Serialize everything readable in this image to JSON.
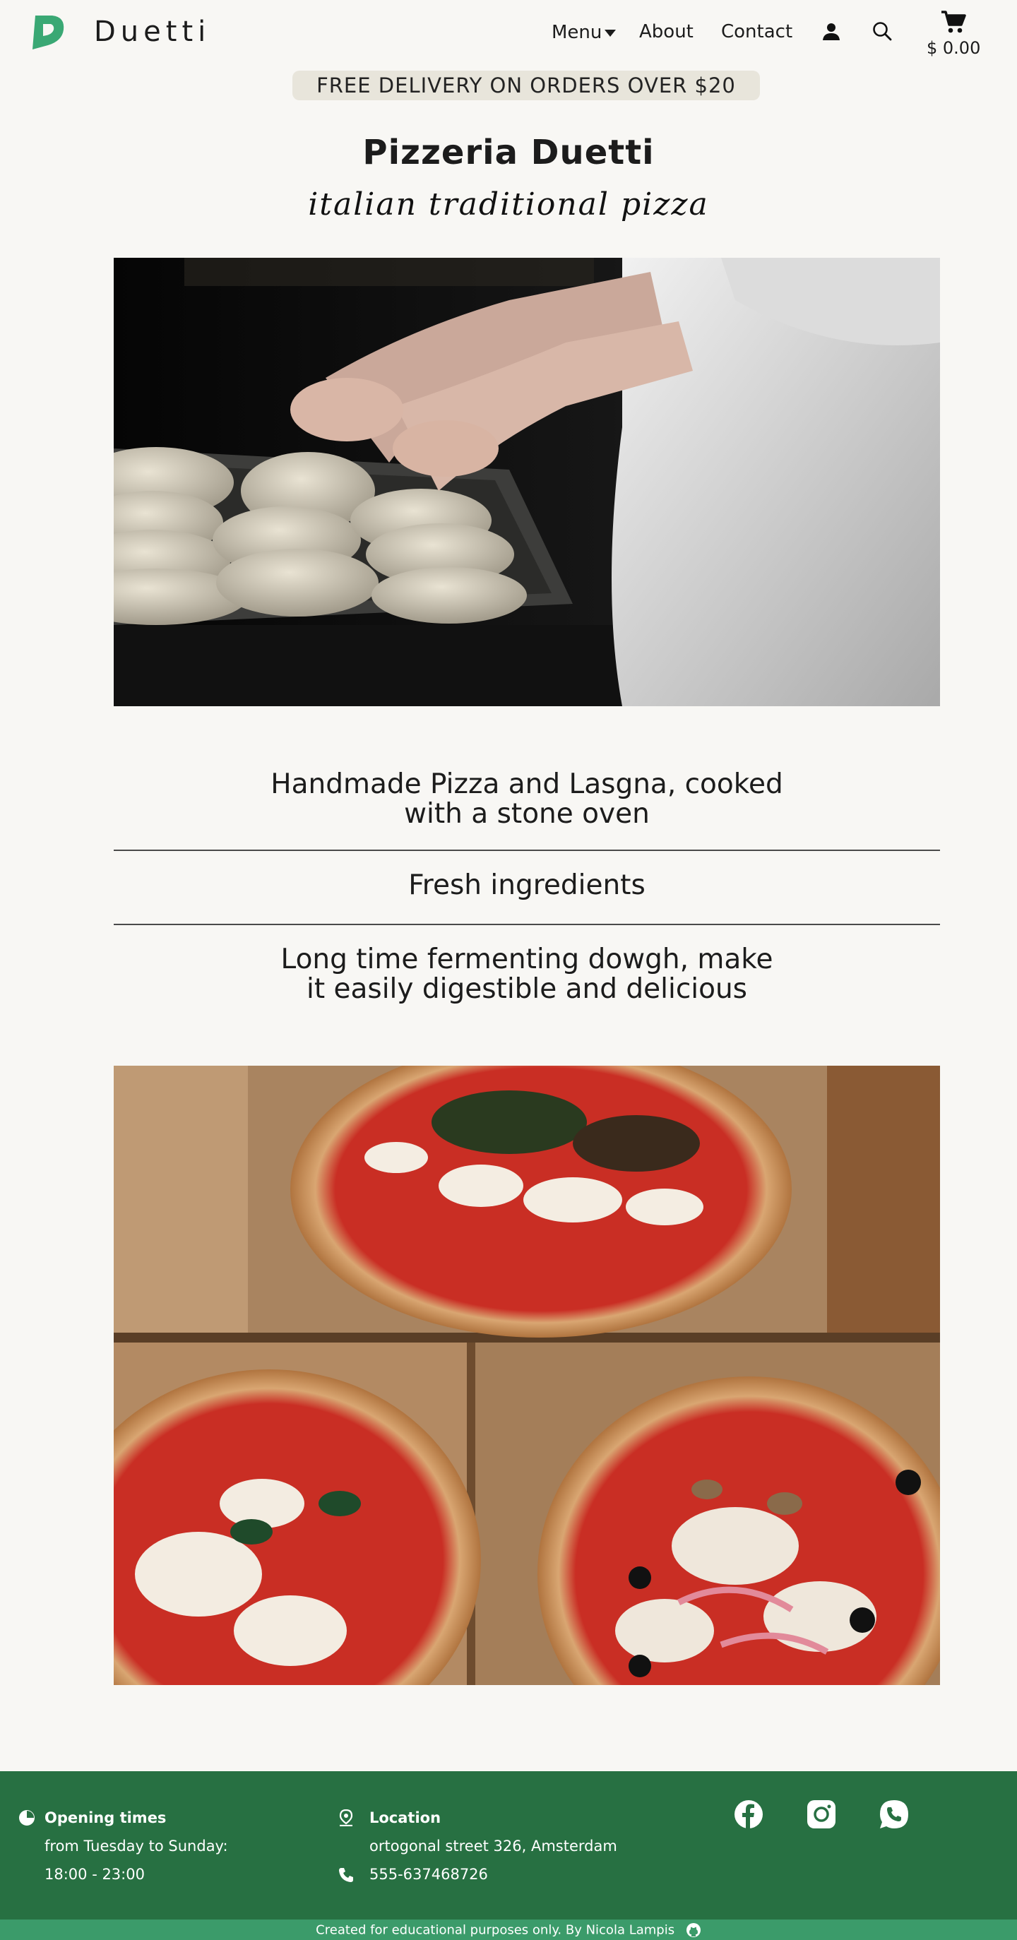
{
  "header": {
    "brand": "Duetti",
    "nav": {
      "menu": "Menu",
      "about": "About",
      "contact": "Contact"
    },
    "cart_total": "$ 0.00",
    "icons": [
      "logo-icon",
      "user-icon",
      "search-icon",
      "cart-icon"
    ]
  },
  "promo": "FREE DELIVERY ON ORDERS OVER $20",
  "title": "Pizzeria Duetti",
  "tagline": "italian traditional pizza",
  "features": [
    "Handmade Pizza and Lasgna, cooked with a stone oven",
    "Fresh ingredients",
    "Long time fermenting dowgh, make it easily digestible and delicious"
  ],
  "footer": {
    "hours": {
      "heading": "Opening times",
      "days": "from Tuesday to Sunday:",
      "time": "18:00 - 23:00"
    },
    "location": {
      "heading": "Location",
      "address": "ortogonal street 326, Amsterdam",
      "phone": "555-637468726"
    },
    "socials": [
      "facebook-icon",
      "instagram-icon",
      "whatsapp-icon"
    ],
    "credit": "Created for educational purposes only.  By Nicola Lampis"
  },
  "colors": {
    "footer_bg": "#277042",
    "credit_bg": "#3b9b6a",
    "brand_green": "#3aa874",
    "promo_bg": "#e8e5db"
  }
}
